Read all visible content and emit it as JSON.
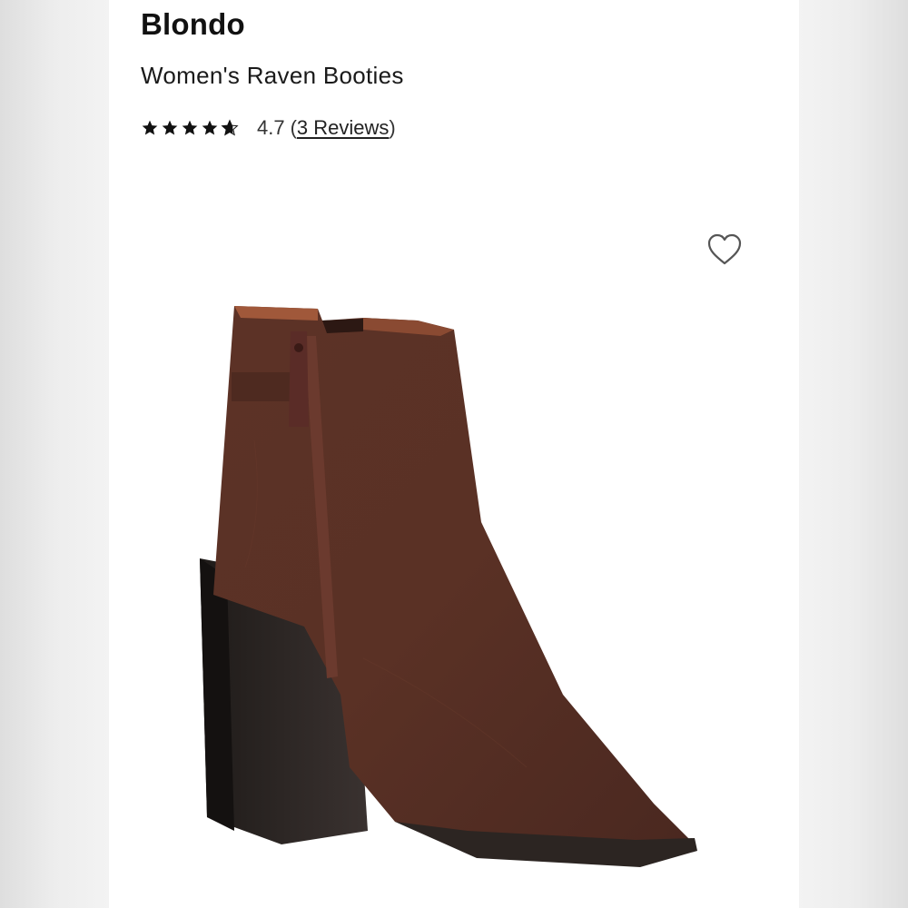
{
  "product": {
    "brand": "Blondo",
    "name": "Women's Raven Booties",
    "rating": {
      "stars": 4.7,
      "max_stars": 5,
      "value_label": "4.7",
      "reviews_label": "3 Reviews"
    }
  },
  "icons": {
    "wishlist": "heart-outline-icon",
    "star": "star-icon"
  },
  "colors": {
    "text": "#111111",
    "suede": "#5a3328",
    "heel": "#2b2522"
  }
}
